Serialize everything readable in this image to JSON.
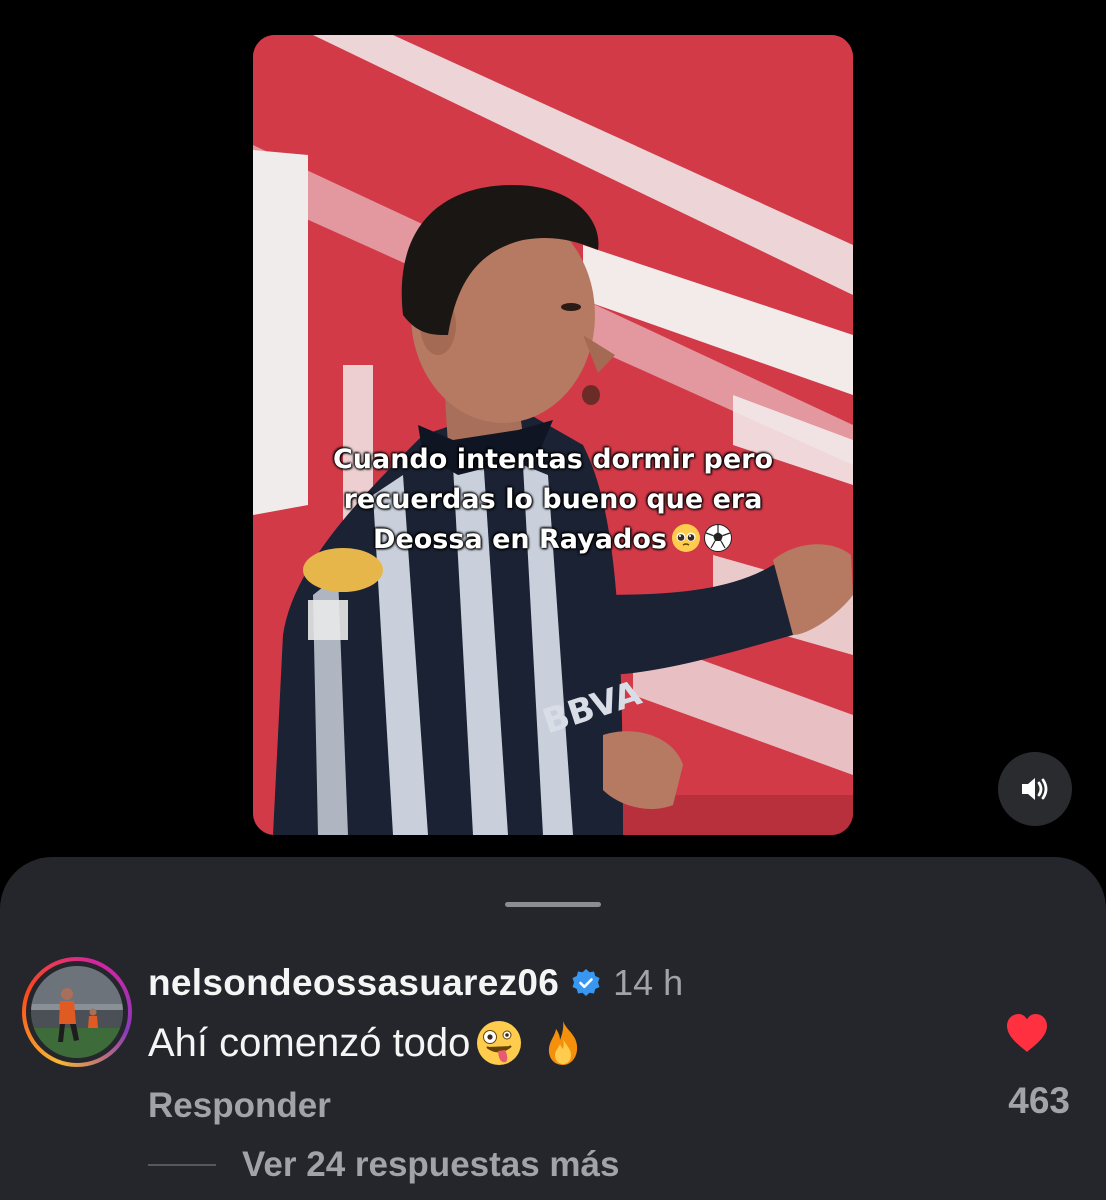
{
  "video": {
    "caption_line1": "Cuando intentas dormir pero",
    "caption_line2": "recuerdas lo bueno que era",
    "caption_line3": "Deossa en Rayados",
    "caption_emojis": [
      "pleading-face-emoji",
      "soccer-ball-emoji"
    ],
    "jersey_text": "BBVA",
    "sound_icon": "speaker-on-icon"
  },
  "comment": {
    "username": "nelsondeossasuarez06",
    "verified_icon": "verified-badge-icon",
    "time": "14 h",
    "text": "Ahí comenzó todo",
    "text_emojis": [
      "zany-face-emoji",
      "fire-emoji"
    ],
    "reply_label": "Responder",
    "like_icon": "heart-icon",
    "liked": true,
    "like_count": "463",
    "view_replies_label": "Ver 24 respuestas más"
  },
  "colors": {
    "background": "#000000",
    "sheet": "#24262b",
    "primary_text": "#f5f5f5",
    "secondary_text": "#a0a3a8",
    "heart": "#ff3040",
    "verified": "#3897f0",
    "video_red": "#d23a48"
  }
}
